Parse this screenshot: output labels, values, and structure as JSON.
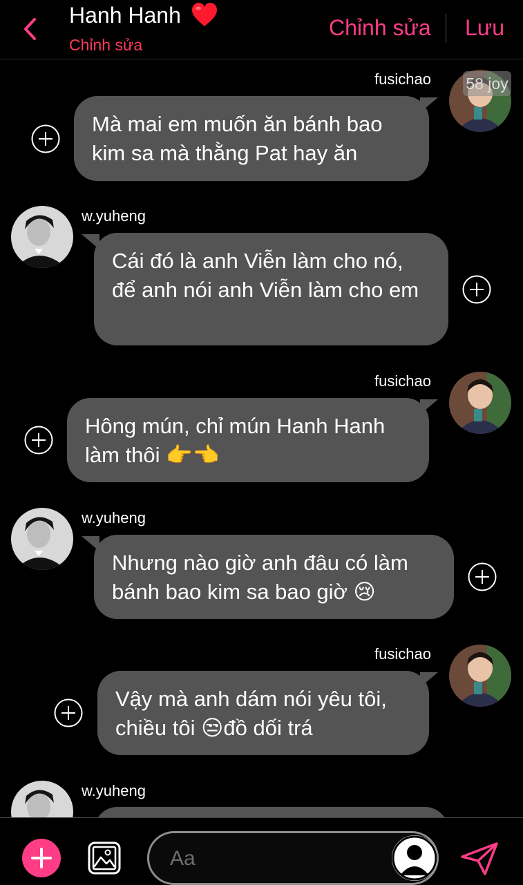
{
  "header": {
    "title": "Hanh Hanh",
    "subtitle": "Chỉnh sửa",
    "edit_label": "Chỉnh sửa",
    "save_label": "Lưu"
  },
  "watermark": "58 joy",
  "messages": [
    {
      "sender": "fusichao",
      "side": "right",
      "text": "Mà mai em muốn ăn bánh bao kim sa mà thằng Pat hay ăn"
    },
    {
      "sender": "w.yuheng",
      "side": "left",
      "text": "Cái đó là anh Viễn làm cho nó, để anh nói anh Viễn làm cho em"
    },
    {
      "sender": "fusichao",
      "side": "right",
      "text": "Hông mún, chỉ mún Hanh Hanh làm thôi 👉👈"
    },
    {
      "sender": "w.yuheng",
      "side": "left",
      "text": "Nhưng nào giờ anh đâu có làm bánh bao kim sa bao giờ 😢"
    },
    {
      "sender": "fusichao",
      "side": "right",
      "text": "Vậy mà anh dám nói yêu tôi, chiều tôi 😒đồ dối trá"
    },
    {
      "sender": "w.yuheng",
      "side": "left",
      "text": ""
    }
  ],
  "composer": {
    "placeholder": "Aa"
  },
  "colors": {
    "accent": "#ff3c86",
    "subtitle": "#ff3b5c",
    "bubble": "#545454",
    "background": "#000000"
  },
  "icons": {
    "back": "chevron-left-icon",
    "heart": "heart-icon",
    "plus": "plus-circle-icon",
    "image": "image-icon",
    "profile": "profile-icon",
    "send": "send-icon"
  }
}
